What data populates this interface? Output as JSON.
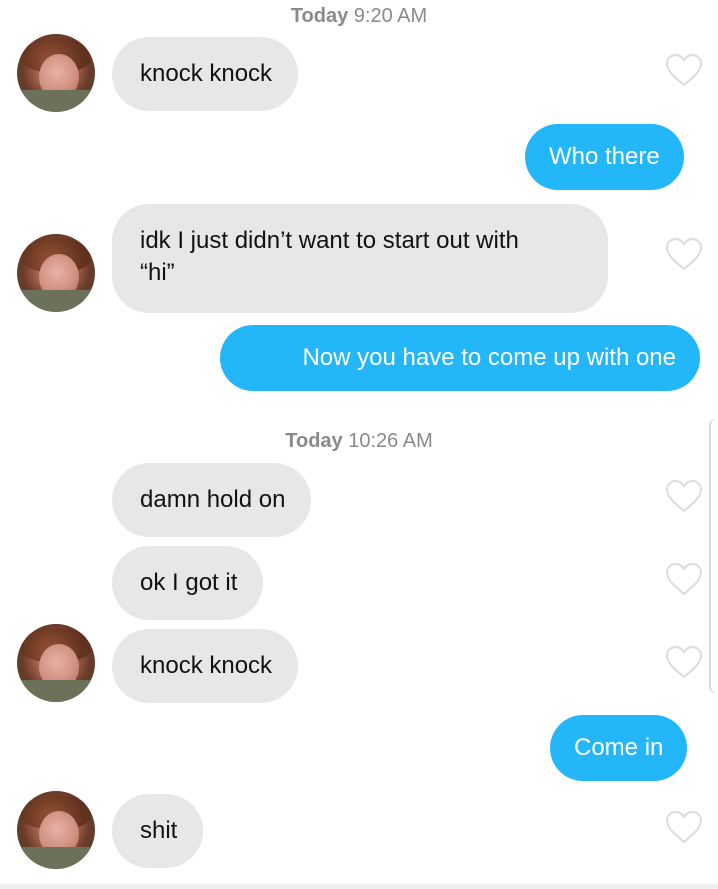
{
  "messages_view": {
    "timestamps": [
      {
        "day": "Today",
        "time": "9:20 AM"
      },
      {
        "day": "Today",
        "time": "10:26 AM"
      }
    ],
    "messages": [
      {
        "direction": "incoming",
        "lines": [
          "knock knock"
        ]
      },
      {
        "direction": "outgoing",
        "lines": [
          "Who there"
        ]
      },
      {
        "direction": "incoming",
        "lines": [
          "idk I just didn’t want to start out with",
          "“hi”"
        ]
      },
      {
        "direction": "outgoing",
        "lines": [
          "Now you have to come up with one"
        ]
      },
      {
        "direction": "incoming",
        "lines": [
          "damn hold on"
        ]
      },
      {
        "direction": "incoming",
        "lines": [
          "ok I got it"
        ]
      },
      {
        "direction": "incoming",
        "lines": [
          "knock knock"
        ]
      },
      {
        "direction": "outgoing",
        "lines": [
          "Come in"
        ]
      },
      {
        "direction": "incoming",
        "lines": [
          "shit"
        ]
      }
    ],
    "icons": {
      "like": "heart-outline-icon",
      "avatar": "contact-avatar"
    },
    "colors": {
      "incoming_bubble": "#e7e7e7",
      "outgoing_bubble": "#23b7fa",
      "timestamp_text": "#8a8a8a",
      "heart_outline": "#dcdcdc"
    }
  }
}
